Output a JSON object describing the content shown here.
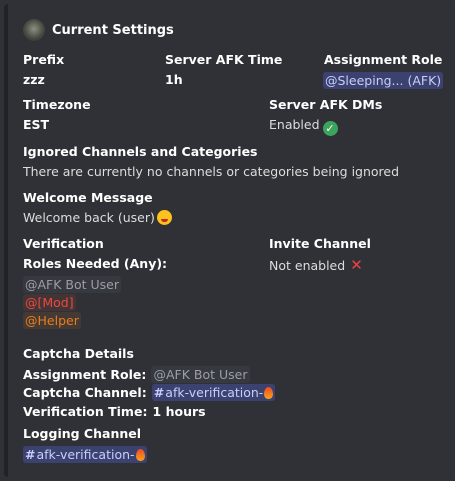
{
  "header": {
    "title": "Current Settings"
  },
  "prefix": {
    "label": "Prefix",
    "value": "zzz"
  },
  "server_afk_time": {
    "label": "Server AFK Time",
    "value": "1h"
  },
  "assignment_role": {
    "label": "Assignment Role",
    "value": "@Sleeping... (AFK)"
  },
  "timezone": {
    "label": "Timezone",
    "value": "EST"
  },
  "server_afk_dms": {
    "label": "Server AFK DMs",
    "value": "Enabled"
  },
  "ignored": {
    "label": "Ignored Channels and Categories",
    "value": "There are currently no channels or categories being ignored"
  },
  "welcome": {
    "label": "Welcome Message",
    "value": "Welcome back (user)"
  },
  "verification": {
    "label": "Verification",
    "roles_needed_label": "Roles Needed (Any):",
    "roles": [
      "@AFK Bot User",
      "@[Mod]",
      "@Helper"
    ]
  },
  "invite_channel": {
    "label": "Invite Channel",
    "value": "Not enabled"
  },
  "captcha": {
    "label": "Captcha Details",
    "assignment_role_label": "Assignment Role:",
    "assignment_role_value": "@AFK Bot User",
    "channel_label": "Captcha Channel:",
    "channel_value": "afk-verification-",
    "time_label": "Verification Time:",
    "time_value": "1 hours"
  },
  "logging": {
    "label": "Logging Channel",
    "channel_value": "afk-verification-"
  },
  "colors": {
    "mention_default": "#c9cdfb",
    "role_mod": "#e74c3c",
    "role_helper": "#e67e22",
    "enabled": "#3ba55d",
    "disabled": "#ed4245"
  }
}
